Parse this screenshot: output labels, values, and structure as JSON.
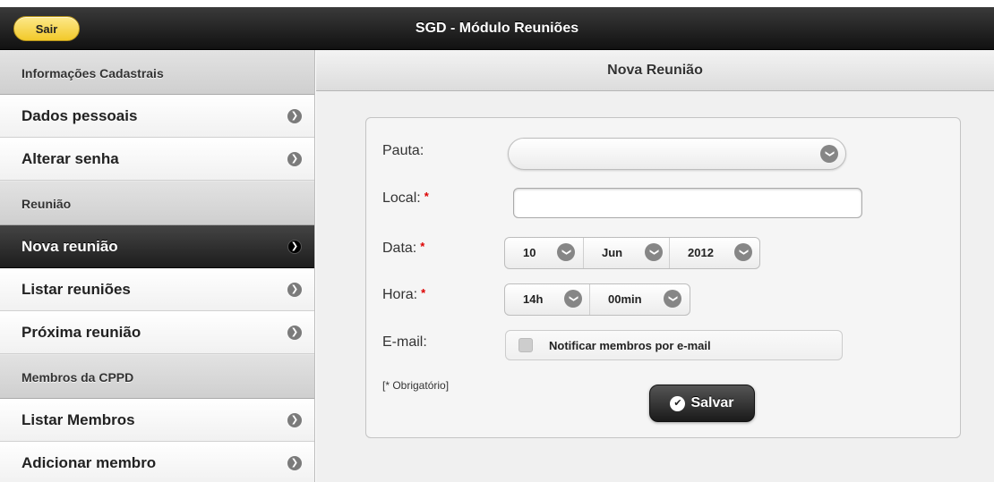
{
  "header": {
    "title": "SGD - Módulo Reuniões",
    "exit_label": "Sair"
  },
  "sidebar": {
    "sections": [
      {
        "label": "Informações Cadastrais",
        "items": [
          {
            "label": "Dados pessoais",
            "icon": "chevron-right-icon"
          },
          {
            "label": "Alterar senha",
            "icon": "chevron-right-icon"
          }
        ]
      },
      {
        "label": "Reunião",
        "items": [
          {
            "label": "Nova reunião",
            "icon": "chevron-right-icon",
            "active": true
          },
          {
            "label": "Listar reuniões",
            "icon": "chevron-right-icon"
          },
          {
            "label": "Próxima reunião",
            "icon": "chevron-right-icon"
          }
        ]
      },
      {
        "label": "Membros da CPPD",
        "items": [
          {
            "label": "Listar Membros",
            "icon": "chevron-right-icon"
          },
          {
            "label": "Adicionar membro",
            "icon": "chevron-right-icon"
          }
        ]
      }
    ]
  },
  "main": {
    "title": "Nova Reunião",
    "form": {
      "pauta_label": "Pauta:",
      "pauta_value": "",
      "local_label": "Local:",
      "local_value": "",
      "data_label": "Data:",
      "data_day": "10",
      "data_month": "Jun",
      "data_year": "2012",
      "hora_label": "Hora:",
      "hora_hour": "14h",
      "hora_min": "00min",
      "email_label": "E-mail:",
      "email_checkbox_label": "Notificar membros por e-mail",
      "email_checked": false,
      "required_marker": "*",
      "required_note": "[* Obrigatório]",
      "save_label": "Salvar",
      "save_icon": "checkmark-icon"
    }
  },
  "colors": {
    "topbar": "#1a1a1a",
    "exit_button": "#f5d040",
    "active_item": "#222222",
    "required": "#dd0000"
  }
}
